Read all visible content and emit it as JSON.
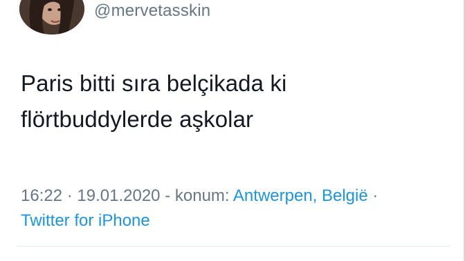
{
  "user": {
    "handle": "@mervetasskin"
  },
  "tweet": {
    "lines": [
      "Paris bitti sıra belçikada ki",
      "flörtbuddylerde aşkolar"
    ]
  },
  "meta": {
    "time": "16:22",
    "date": "19.01.2020",
    "location_prefix": "konum:",
    "location": "Antwerpen, België",
    "sep": "·",
    "dash": "-",
    "source": "Twitter for iPhone"
  },
  "colors": {
    "text": "#141823",
    "secondary": "#657786",
    "link": "#1b95e0"
  }
}
